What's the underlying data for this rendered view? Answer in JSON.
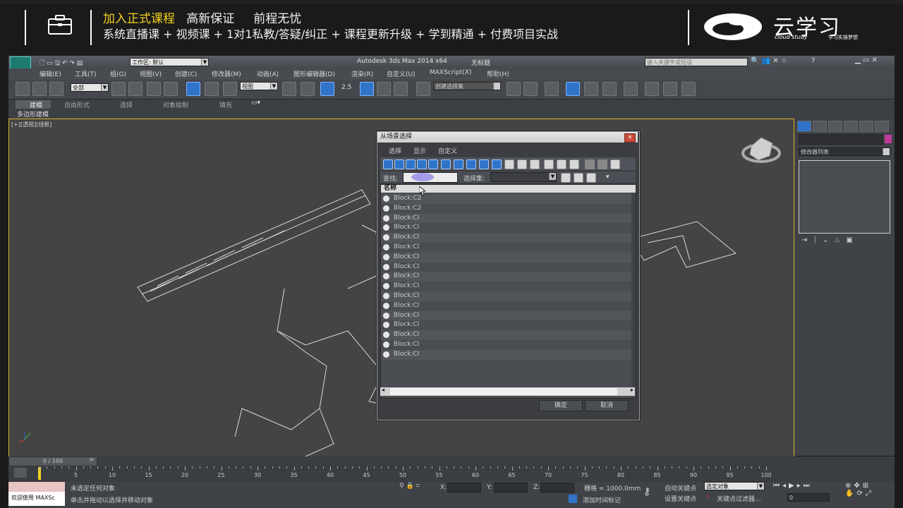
{
  "banner": {
    "line1_prefix": "加入正式课程",
    "line1_rest": "   高新保证     前程无忧",
    "line2": "系统直播课 + 视频课 + 1对1私教/答疑/纠正 + 课程更新升级 + 学到精通 + 付费项目实战",
    "logo_text": "云学习",
    "logo_sub": "cloud study",
    "logo_sub2": "学习实操梦想",
    "highlight_color": "#f4d21f"
  },
  "app": {
    "workspace_label": "工作区: 默认",
    "title": "Autodesk 3ds Max  2014 x64",
    "doc_title": "无标题",
    "search_placeholder": "键入关键字或短语",
    "help_label": "?"
  },
  "menu": [
    "编辑(E)",
    "工具(T)",
    "组(G)",
    "视图(V)",
    "创建(C)",
    "修改器(M)",
    "动画(A)",
    "图形编辑器(D)",
    "渲染(R)",
    "自定义(U)",
    "MAXScript(X)",
    "帮助(H)"
  ],
  "toolbar": {
    "filter_value": "全部",
    "refcoord_value": "视图",
    "snap_value": "2.5",
    "selset_value": "创建选择集"
  },
  "ribbon": {
    "tabs": [
      "建模",
      "自由形式",
      "选择",
      "对象绘制",
      "填充"
    ],
    "sub_label": "多边形建模"
  },
  "viewport": {
    "label": "[+][透视][线框]"
  },
  "dialog": {
    "title": "从场景选择",
    "close": "✕",
    "menu": [
      "选择",
      "显示",
      "自定义"
    ],
    "find_label": "查找:",
    "find_value": "",
    "selset_label": "选择集:",
    "list_header": "名称",
    "items": [
      "Block:C2",
      "Block:C2",
      "Block:CI",
      "Block:CI",
      "Block:CI",
      "Block:CI",
      "Block:CI",
      "Block:CI",
      "Block:CI",
      "Block:CI",
      "Block:CI",
      "Block:CI",
      "Block:CI",
      "Block:CI",
      "Block:CI",
      "Block:CI",
      "Block:CI"
    ],
    "ok": "确定",
    "cancel": "取消"
  },
  "command_panel": {
    "modifier_list": "修改器列表"
  },
  "timeline": {
    "frame_display": "0 / 100",
    "ticks": [
      "0",
      "5",
      "10",
      "15",
      "20",
      "25",
      "30",
      "35",
      "40",
      "45",
      "50",
      "55",
      "60",
      "65",
      "70",
      "75",
      "80",
      "85",
      "90",
      "95",
      "100"
    ]
  },
  "status": {
    "welcome": "欢迎使用 MAXSc",
    "line1": "未选定任何对象",
    "line2": "单击并拖动以选择并移动对象",
    "x_label": "X:",
    "y_label": "Y:",
    "z_label": "Z:",
    "grid": "栅格 = 1000.0mm",
    "add_time_tag": "添加时间标记",
    "auto_key": "自动关键点",
    "set_key": "设置关键点",
    "selected_object": "选定对象",
    "key_filters": "关键点过滤器...",
    "frame_value": "0"
  }
}
